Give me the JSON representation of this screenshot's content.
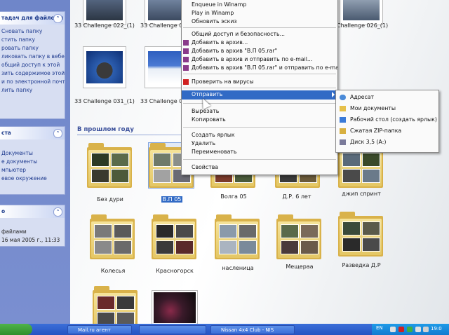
{
  "left_panel": {
    "box1": {
      "title": "тадач для файлов и папок",
      "items": [
        "Сновать папку",
        "стить папку",
        "ровать папку",
        "ликовать папку в вебе",
        "общий доступ к этой",
        "",
        "зить содержимое этой",
        "и по электронной почте",
        "лить папку"
      ]
    },
    "box2": {
      "title": "ста",
      "items": [
        "Документы",
        "е документы",
        "мпьютер",
        "евое окружение"
      ]
    },
    "box3": {
      "title": "о",
      "items": [
        "файлами",
        "16 мая 2005 г., 11:33"
      ]
    }
  },
  "top_thumbnails": [
    {
      "caption": "33 Challenge 022_(1)"
    },
    {
      "caption": "33 Challenge 0"
    },
    {
      "caption": "Challenge 026_(1)"
    },
    {
      "caption": "33 Challenge 031_(1)"
    },
    {
      "caption": "33 Challenge 03"
    }
  ],
  "section_title": "В прошлом году",
  "folders": [
    {
      "name": "Без дури"
    },
    {
      "name": "В.П 05"
    },
    {
      "name": "Волга 05"
    },
    {
      "name": "Д.Р. 6 лет"
    },
    {
      "name": "джип спринт"
    },
    {
      "name": "Колесья"
    },
    {
      "name": "Красногорск"
    },
    {
      "name": "насленица"
    },
    {
      "name": "Мещераа"
    },
    {
      "name": "Разведка Д.Р"
    }
  ],
  "context_menu": {
    "items": [
      "Enqueue in Winamp",
      "Play in Winamp",
      "Обновить эскиз",
      "Общий доступ и безопасность...",
      "Добавить в архив...",
      "Добавить в архив \"В.П 05.rar\"",
      "Добавить в архив и отправить по e-mail...",
      "Добавить в архив \"В.П 05.rar\" и отправить по e-mail",
      "Проверить на вирусы",
      "Отправить",
      "Вырезать",
      "Копировать",
      "Создать ярлык",
      "Удалить",
      "Переименовать",
      "Свойства"
    ]
  },
  "submenu": {
    "items": [
      "Адресат",
      "Мои документы",
      "Рабочий стол (создать ярлык)",
      "Сжатая ZIP-папка",
      "Диск 3,5 (A:)"
    ]
  },
  "taskbar": {
    "tasks": [
      "Mail.ru агент",
      "",
      "Nissan 4x4 Club - NIS"
    ],
    "lang": "EN",
    "clock": "19:0"
  },
  "colors": {
    "selection": "#316ac5",
    "panel_blue": "#7a8fd0",
    "folder_yellow": "#e4c765"
  }
}
